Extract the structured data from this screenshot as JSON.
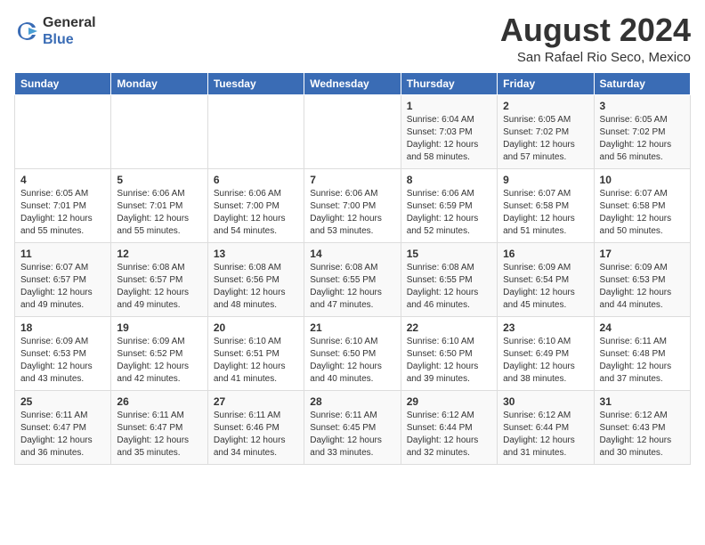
{
  "header": {
    "logo_line1": "General",
    "logo_line2": "Blue",
    "month_year": "August 2024",
    "location": "San Rafael Rio Seco, Mexico"
  },
  "weekdays": [
    "Sunday",
    "Monday",
    "Tuesday",
    "Wednesday",
    "Thursday",
    "Friday",
    "Saturday"
  ],
  "weeks": [
    [
      {
        "day": "",
        "info": ""
      },
      {
        "day": "",
        "info": ""
      },
      {
        "day": "",
        "info": ""
      },
      {
        "day": "",
        "info": ""
      },
      {
        "day": "1",
        "info": "Sunrise: 6:04 AM\nSunset: 7:03 PM\nDaylight: 12 hours\nand 58 minutes."
      },
      {
        "day": "2",
        "info": "Sunrise: 6:05 AM\nSunset: 7:02 PM\nDaylight: 12 hours\nand 57 minutes."
      },
      {
        "day": "3",
        "info": "Sunrise: 6:05 AM\nSunset: 7:02 PM\nDaylight: 12 hours\nand 56 minutes."
      }
    ],
    [
      {
        "day": "4",
        "info": "Sunrise: 6:05 AM\nSunset: 7:01 PM\nDaylight: 12 hours\nand 55 minutes."
      },
      {
        "day": "5",
        "info": "Sunrise: 6:06 AM\nSunset: 7:01 PM\nDaylight: 12 hours\nand 55 minutes."
      },
      {
        "day": "6",
        "info": "Sunrise: 6:06 AM\nSunset: 7:00 PM\nDaylight: 12 hours\nand 54 minutes."
      },
      {
        "day": "7",
        "info": "Sunrise: 6:06 AM\nSunset: 7:00 PM\nDaylight: 12 hours\nand 53 minutes."
      },
      {
        "day": "8",
        "info": "Sunrise: 6:06 AM\nSunset: 6:59 PM\nDaylight: 12 hours\nand 52 minutes."
      },
      {
        "day": "9",
        "info": "Sunrise: 6:07 AM\nSunset: 6:58 PM\nDaylight: 12 hours\nand 51 minutes."
      },
      {
        "day": "10",
        "info": "Sunrise: 6:07 AM\nSunset: 6:58 PM\nDaylight: 12 hours\nand 50 minutes."
      }
    ],
    [
      {
        "day": "11",
        "info": "Sunrise: 6:07 AM\nSunset: 6:57 PM\nDaylight: 12 hours\nand 49 minutes."
      },
      {
        "day": "12",
        "info": "Sunrise: 6:08 AM\nSunset: 6:57 PM\nDaylight: 12 hours\nand 49 minutes."
      },
      {
        "day": "13",
        "info": "Sunrise: 6:08 AM\nSunset: 6:56 PM\nDaylight: 12 hours\nand 48 minutes."
      },
      {
        "day": "14",
        "info": "Sunrise: 6:08 AM\nSunset: 6:55 PM\nDaylight: 12 hours\nand 47 minutes."
      },
      {
        "day": "15",
        "info": "Sunrise: 6:08 AM\nSunset: 6:55 PM\nDaylight: 12 hours\nand 46 minutes."
      },
      {
        "day": "16",
        "info": "Sunrise: 6:09 AM\nSunset: 6:54 PM\nDaylight: 12 hours\nand 45 minutes."
      },
      {
        "day": "17",
        "info": "Sunrise: 6:09 AM\nSunset: 6:53 PM\nDaylight: 12 hours\nand 44 minutes."
      }
    ],
    [
      {
        "day": "18",
        "info": "Sunrise: 6:09 AM\nSunset: 6:53 PM\nDaylight: 12 hours\nand 43 minutes."
      },
      {
        "day": "19",
        "info": "Sunrise: 6:09 AM\nSunset: 6:52 PM\nDaylight: 12 hours\nand 42 minutes."
      },
      {
        "day": "20",
        "info": "Sunrise: 6:10 AM\nSunset: 6:51 PM\nDaylight: 12 hours\nand 41 minutes."
      },
      {
        "day": "21",
        "info": "Sunrise: 6:10 AM\nSunset: 6:50 PM\nDaylight: 12 hours\nand 40 minutes."
      },
      {
        "day": "22",
        "info": "Sunrise: 6:10 AM\nSunset: 6:50 PM\nDaylight: 12 hours\nand 39 minutes."
      },
      {
        "day": "23",
        "info": "Sunrise: 6:10 AM\nSunset: 6:49 PM\nDaylight: 12 hours\nand 38 minutes."
      },
      {
        "day": "24",
        "info": "Sunrise: 6:11 AM\nSunset: 6:48 PM\nDaylight: 12 hours\nand 37 minutes."
      }
    ],
    [
      {
        "day": "25",
        "info": "Sunrise: 6:11 AM\nSunset: 6:47 PM\nDaylight: 12 hours\nand 36 minutes."
      },
      {
        "day": "26",
        "info": "Sunrise: 6:11 AM\nSunset: 6:47 PM\nDaylight: 12 hours\nand 35 minutes."
      },
      {
        "day": "27",
        "info": "Sunrise: 6:11 AM\nSunset: 6:46 PM\nDaylight: 12 hours\nand 34 minutes."
      },
      {
        "day": "28",
        "info": "Sunrise: 6:11 AM\nSunset: 6:45 PM\nDaylight: 12 hours\nand 33 minutes."
      },
      {
        "day": "29",
        "info": "Sunrise: 6:12 AM\nSunset: 6:44 PM\nDaylight: 12 hours\nand 32 minutes."
      },
      {
        "day": "30",
        "info": "Sunrise: 6:12 AM\nSunset: 6:44 PM\nDaylight: 12 hours\nand 31 minutes."
      },
      {
        "day": "31",
        "info": "Sunrise: 6:12 AM\nSunset: 6:43 PM\nDaylight: 12 hours\nand 30 minutes."
      }
    ]
  ]
}
